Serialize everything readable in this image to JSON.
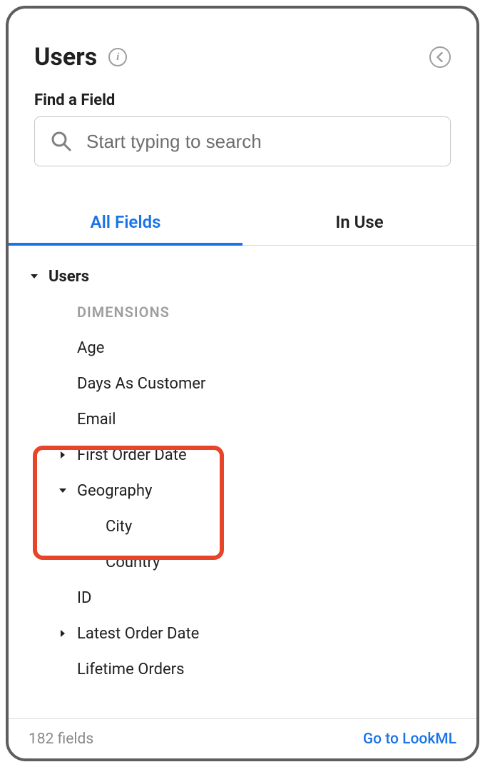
{
  "header": {
    "title": "Users"
  },
  "search": {
    "label": "Find a Field",
    "placeholder": "Start typing to search"
  },
  "tabs": {
    "all_fields": "All Fields",
    "in_use": "In Use"
  },
  "tree": {
    "view_label": "Users",
    "dimensions_header": "DIMENSIONS",
    "fields": [
      {
        "label": "Age",
        "expander": null
      },
      {
        "label": "Days As Customer",
        "expander": null
      },
      {
        "label": "Email",
        "expander": null
      },
      {
        "label": "First Order Date",
        "expander": "collapsed"
      },
      {
        "label": "Geography",
        "expander": "expanded",
        "children": [
          {
            "label": "City"
          },
          {
            "label": "Country"
          }
        ]
      },
      {
        "label": "ID",
        "expander": null
      },
      {
        "label": "Latest Order Date",
        "expander": "collapsed"
      },
      {
        "label": "Lifetime Orders",
        "expander": null
      }
    ]
  },
  "footer": {
    "fields_count": "182 fields",
    "lookml_link": "Go to LookML"
  },
  "highlight": {
    "target_field": "Geography"
  }
}
